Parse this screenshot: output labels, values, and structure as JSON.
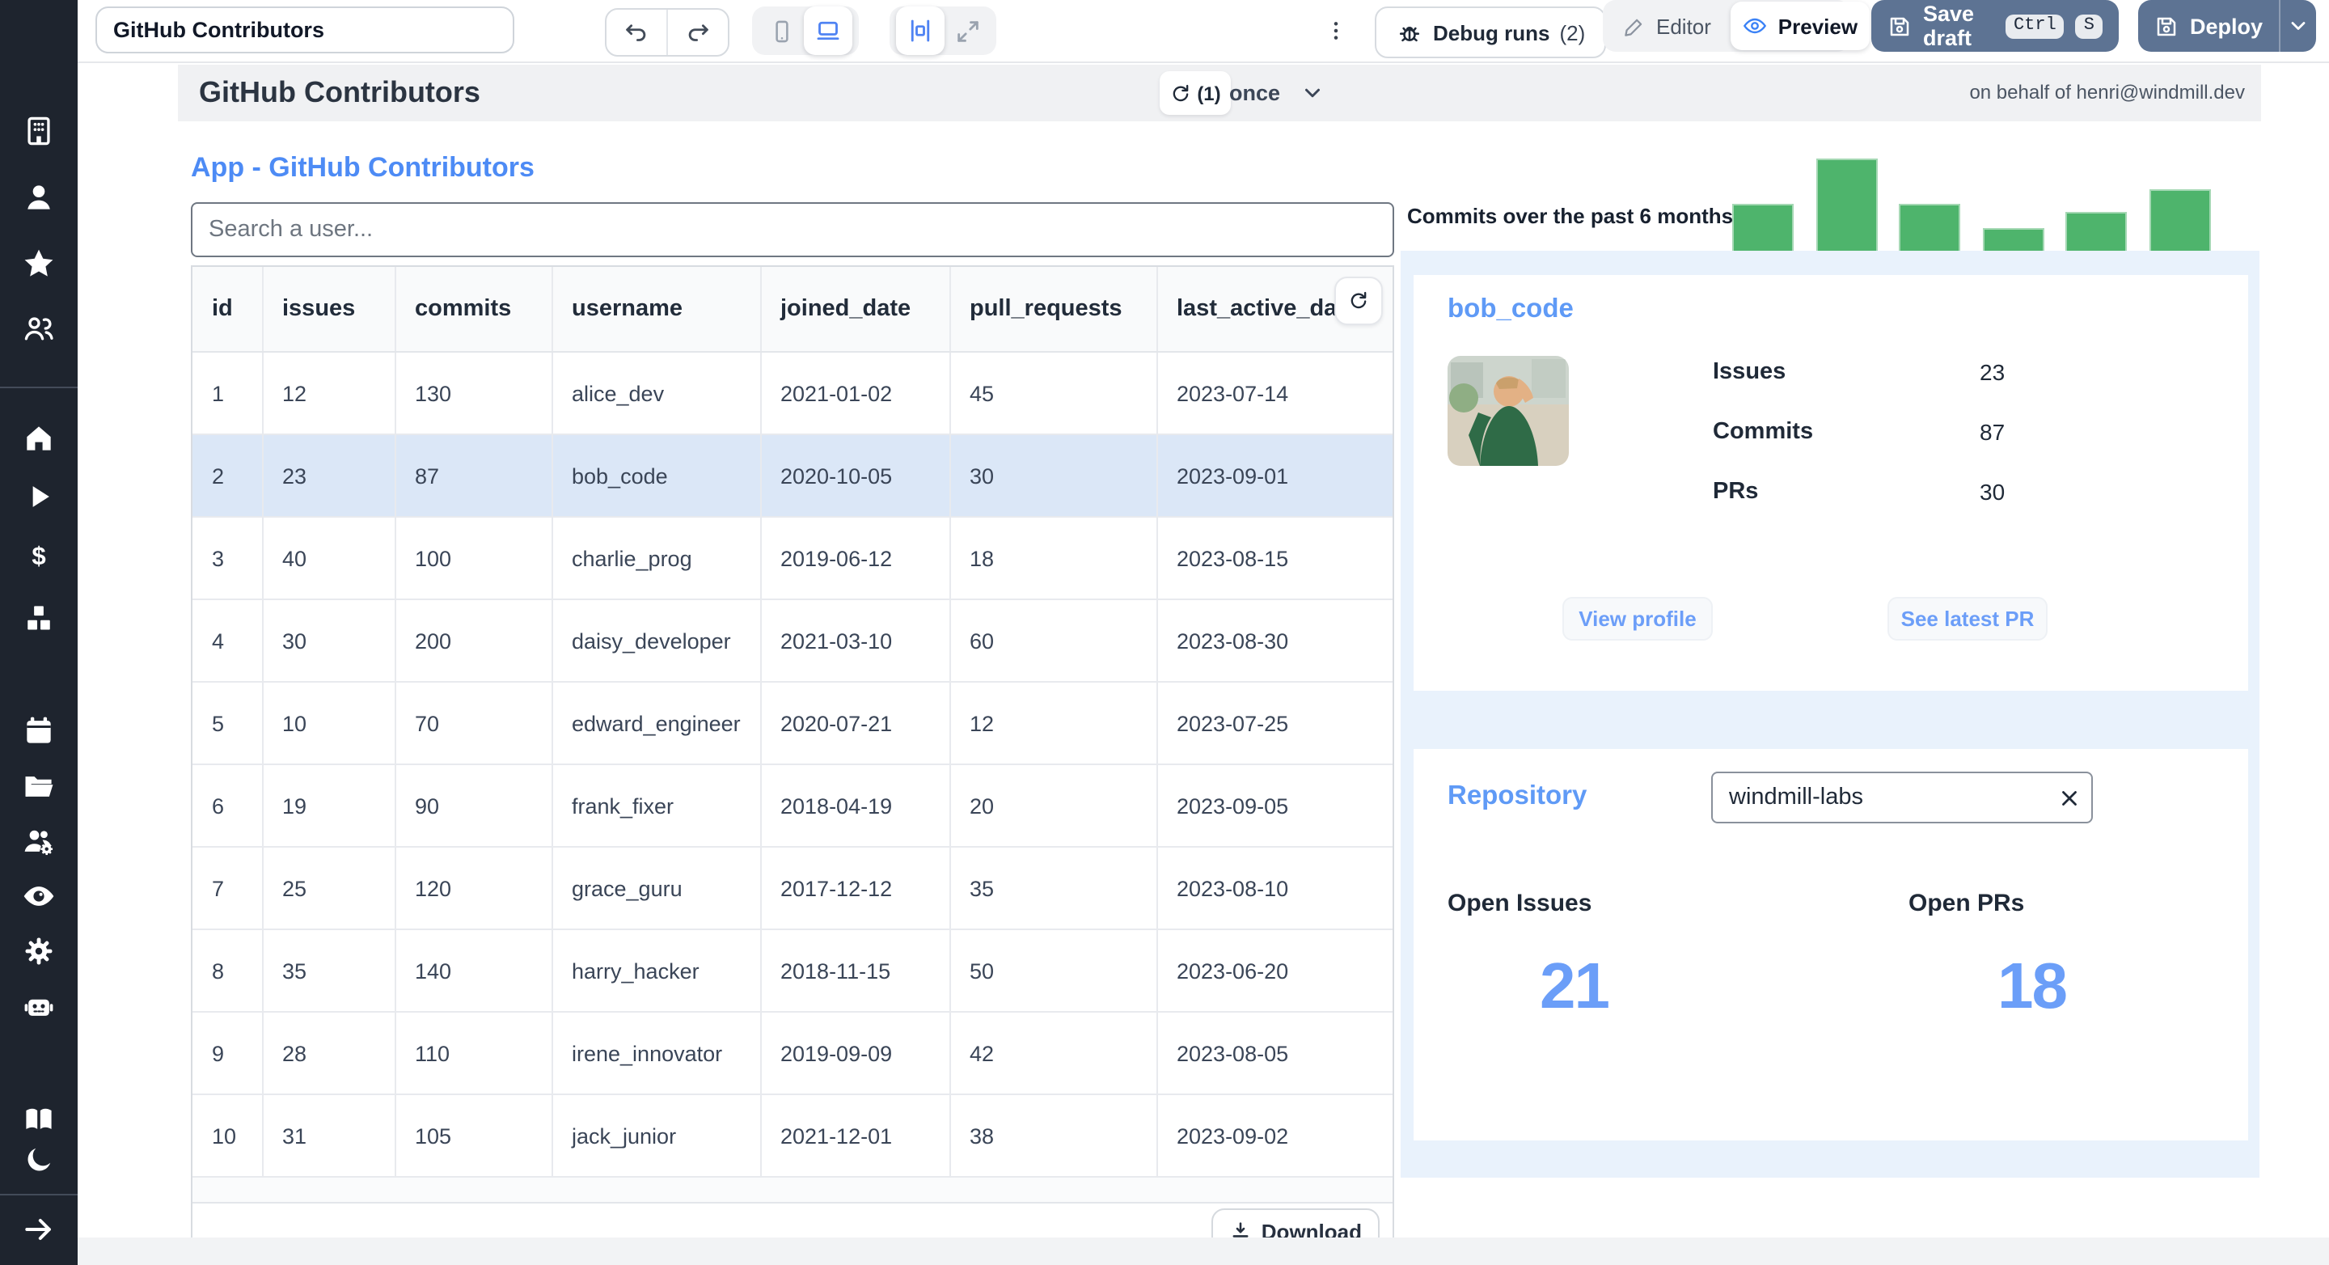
{
  "topbar": {
    "app_title_input": "GitHub Contributors",
    "debug_runs_label": "Debug runs",
    "debug_runs_count": "(2)",
    "editor_label": "Editor",
    "preview_label": "Preview",
    "save_draft_label": "Save draft",
    "kbd_ctrl": "Ctrl",
    "kbd_s": "S",
    "deploy_label": "Deploy"
  },
  "sidebar": {
    "icons": [
      "windmill-logo",
      "building",
      "user",
      "star",
      "users",
      "home",
      "play",
      "dollar",
      "cubes",
      "calendar",
      "folder",
      "users-settings",
      "eye",
      "settings",
      "robot",
      "book-open",
      "moon",
      "arrow-right"
    ]
  },
  "header": {
    "title": "GitHub Contributors",
    "refresh_count": "(1)",
    "schedule_value": "once",
    "on_behalf": "on behalf of henri@windmill.dev"
  },
  "main": {
    "app_heading": "App - GitHub Contributors",
    "search_placeholder": "Search a user...",
    "download_label": "Download"
  },
  "table": {
    "columns": [
      "id",
      "issues",
      "commits",
      "username",
      "joined_date",
      "pull_requests",
      "last_active_date"
    ],
    "selected_row_index": 1,
    "rows": [
      {
        "id": "1",
        "issues": "12",
        "commits": "130",
        "username": "alice_dev",
        "joined_date": "2021-01-02",
        "pull_requests": "45",
        "last_active_date": "2023-07-14"
      },
      {
        "id": "2",
        "issues": "23",
        "commits": "87",
        "username": "bob_code",
        "joined_date": "2020-10-05",
        "pull_requests": "30",
        "last_active_date": "2023-09-01"
      },
      {
        "id": "3",
        "issues": "40",
        "commits": "100",
        "username": "charlie_prog",
        "joined_date": "2019-06-12",
        "pull_requests": "18",
        "last_active_date": "2023-08-15"
      },
      {
        "id": "4",
        "issues": "30",
        "commits": "200",
        "username": "daisy_developer",
        "joined_date": "2021-03-10",
        "pull_requests": "60",
        "last_active_date": "2023-08-30"
      },
      {
        "id": "5",
        "issues": "10",
        "commits": "70",
        "username": "edward_engineer",
        "joined_date": "2020-07-21",
        "pull_requests": "12",
        "last_active_date": "2023-07-25"
      },
      {
        "id": "6",
        "issues": "19",
        "commits": "90",
        "username": "frank_fixer",
        "joined_date": "2018-04-19",
        "pull_requests": "20",
        "last_active_date": "2023-09-05"
      },
      {
        "id": "7",
        "issues": "25",
        "commits": "120",
        "username": "grace_guru",
        "joined_date": "2017-12-12",
        "pull_requests": "35",
        "last_active_date": "2023-08-10"
      },
      {
        "id": "8",
        "issues": "35",
        "commits": "140",
        "username": "harry_hacker",
        "joined_date": "2018-11-15",
        "pull_requests": "50",
        "last_active_date": "2023-06-20"
      },
      {
        "id": "9",
        "issues": "28",
        "commits": "110",
        "username": "irene_innovator",
        "joined_date": "2019-09-09",
        "pull_requests": "42",
        "last_active_date": "2023-08-05"
      },
      {
        "id": "10",
        "issues": "31",
        "commits": "105",
        "username": "jack_junior",
        "joined_date": "2021-12-01",
        "pull_requests": "38",
        "last_active_date": "2023-09-02"
      }
    ]
  },
  "chart_data": {
    "type": "bar",
    "title": "Commits over the past 6 months:",
    "values": [
      50,
      100,
      50,
      25,
      42,
      66
    ],
    "note": "relative bar heights, no axes or tick labels visible",
    "bar_color": "#4eb46c",
    "legend": false,
    "grid": false
  },
  "profile_card": {
    "username": "bob_code",
    "stats": [
      {
        "label": "Issues",
        "value": "23"
      },
      {
        "label": "Commits",
        "value": "87"
      },
      {
        "label": "PRs",
        "value": "30"
      }
    ],
    "view_profile_label": "View profile",
    "see_latest_pr_label": "See latest PR"
  },
  "repository": {
    "heading": "Repository",
    "input_value": "windmill-labs",
    "open_issues_label": "Open Issues",
    "open_issues_value": "21",
    "open_prs_label": "Open PRs",
    "open_prs_value": "18"
  },
  "colors": {
    "accent_blue": "#4d8bf5",
    "light_blue_text": "#6b9ef8",
    "bar_green": "#4eb46c",
    "panel_blue": "#e9f2fc",
    "selected_row": "#dbe7f7",
    "sidebar_bg": "#1e242e",
    "slate_button": "#5d7393"
  }
}
